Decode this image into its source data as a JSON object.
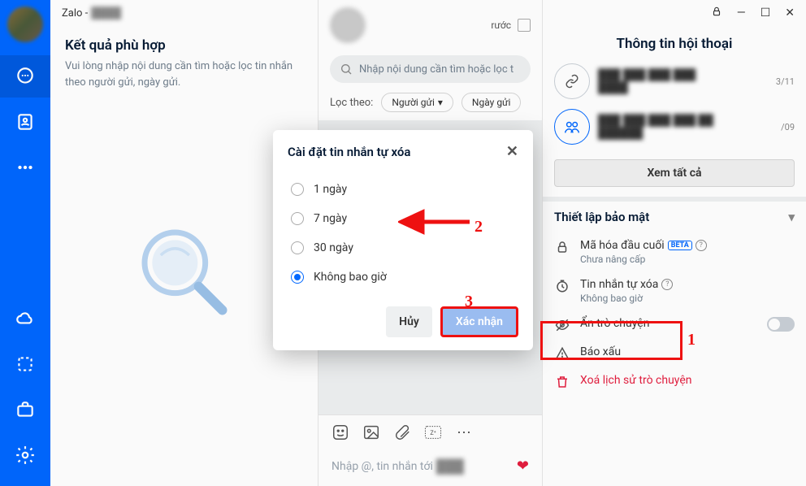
{
  "title_bar": {
    "app": "Zalo -"
  },
  "search": {
    "heading": "Kết quả phù hợp",
    "subtitle": "Vui lòng nhập nội dung cần tìm hoặc lọc tin nhắn theo người gửi, ngày gửi."
  },
  "chat": {
    "back_label": "rước",
    "search_placeholder": "Nhập nội dung cần tìm hoặc lọc t",
    "filter_label": "Lọc theo:",
    "filter_sender": "Người gửi",
    "filter_date": "Ngày gửi",
    "input_placeholder": "Nhập @, tin nhắn tới"
  },
  "info": {
    "title": "Thông tin hội thoại",
    "link1_date": "3/11",
    "link2_date": "/09",
    "view_all": "Xem tất cả",
    "security_section": "Thiết lập bảo mật",
    "e2e_label": "Mã hóa đầu cuối",
    "e2e_beta": "BETA",
    "e2e_sub": "Chưa nâng cấp",
    "auto_delete_label": "Tin nhắn tự xóa",
    "auto_delete_sub": "Không bao giờ",
    "hide_label": "Ẩn trò chuyện",
    "report_label": "Báo xấu",
    "delete_history": "Xoá lịch sử trò chuyện"
  },
  "modal": {
    "title": "Cài đặt tin nhắn tự xóa",
    "opt_1day": "1 ngày",
    "opt_7day": "7 ngày",
    "opt_30day": "30 ngày",
    "opt_never": "Không bao giờ",
    "cancel": "Hủy",
    "confirm": "Xác nhận"
  },
  "annotations": {
    "n1": "1",
    "n2": "2",
    "n3": "3"
  }
}
